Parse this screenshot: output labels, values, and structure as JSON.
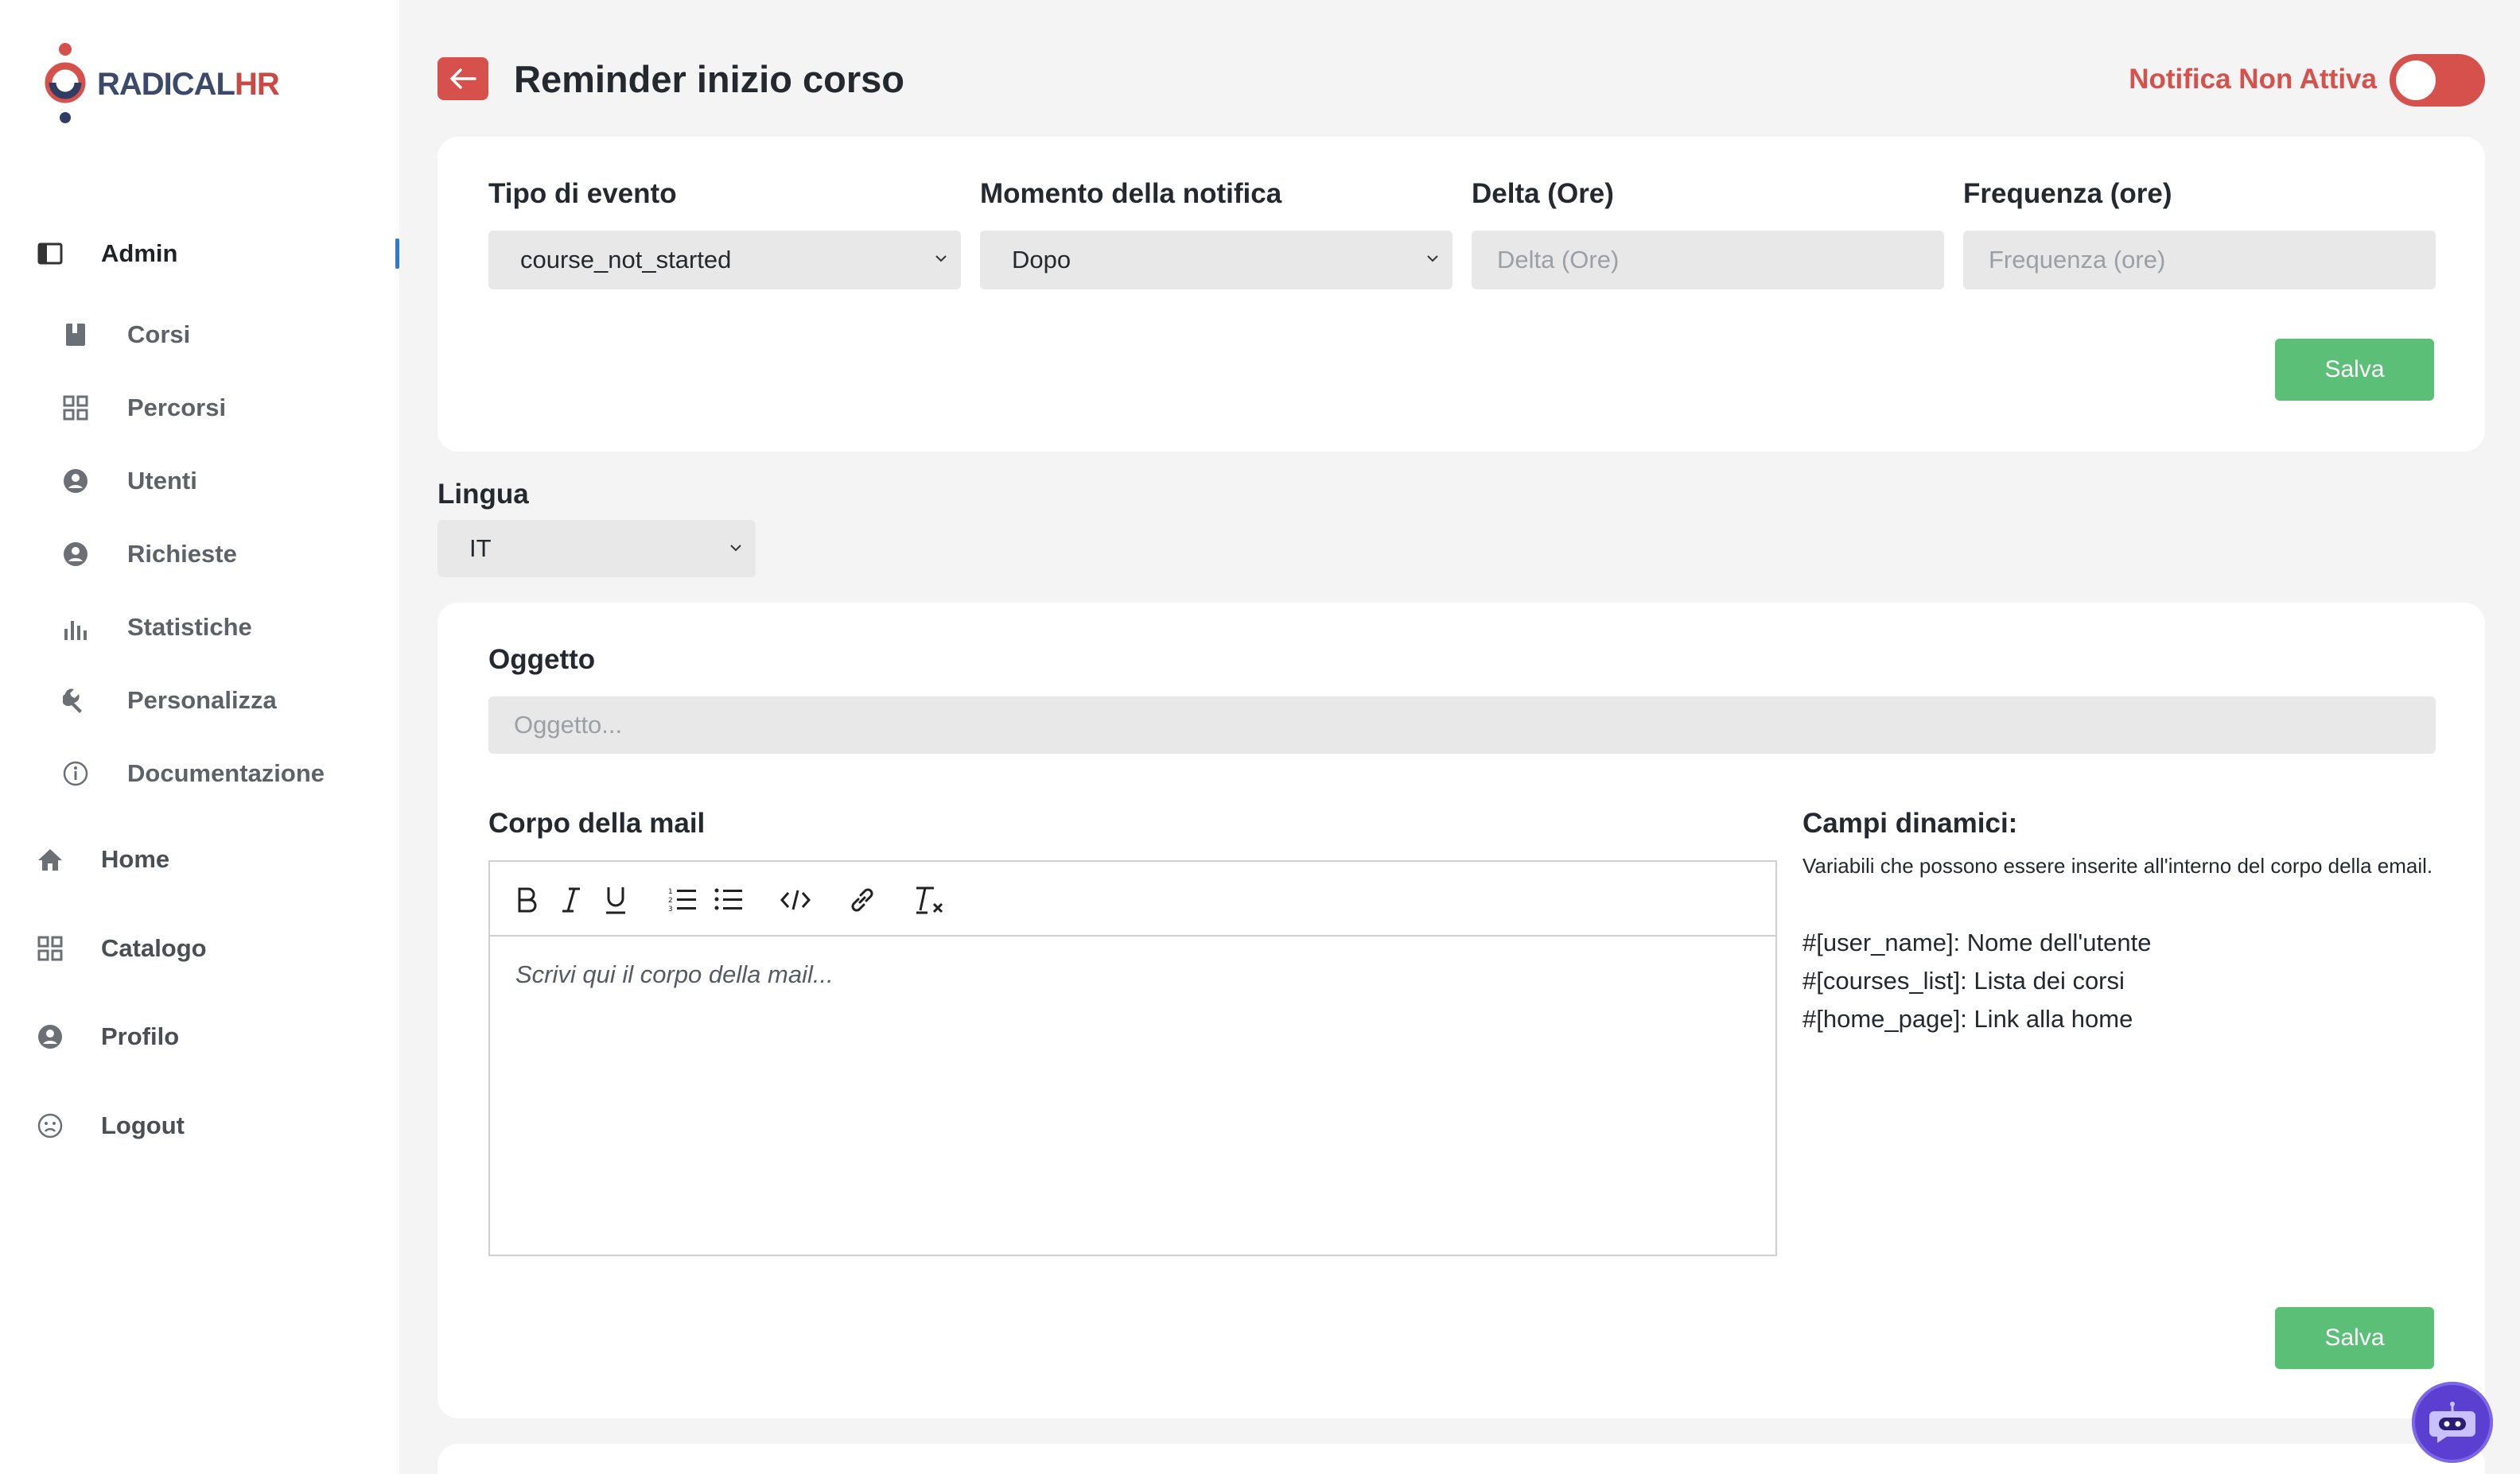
{
  "app": {
    "brand_part1": "RADICAL",
    "brand_part2": "HR"
  },
  "sidebar": {
    "items": [
      {
        "label": "Admin",
        "icon": "sidebar-panel-icon"
      },
      {
        "label": "Corsi",
        "icon": "book-icon"
      },
      {
        "label": "Percorsi",
        "icon": "grid-icon"
      },
      {
        "label": "Utenti",
        "icon": "user-circle-icon"
      },
      {
        "label": "Richieste",
        "icon": "user-circle-icon"
      },
      {
        "label": "Statistiche",
        "icon": "bar-chart-icon"
      },
      {
        "label": "Personalizza",
        "icon": "wrench-icon"
      },
      {
        "label": "Documentazione",
        "icon": "info-icon"
      },
      {
        "label": "Home",
        "icon": "home-icon"
      },
      {
        "label": "Catalogo",
        "icon": "grid-icon"
      },
      {
        "label": "Profilo",
        "icon": "user-circle-icon"
      },
      {
        "label": "Logout",
        "icon": "sad-face-icon"
      }
    ]
  },
  "header": {
    "title": "Reminder inizio corso",
    "notification_status": "Notifica Non Attiva",
    "notification_active": false
  },
  "settings": {
    "event_type_label": "Tipo di evento",
    "event_type_value": "course_not_started",
    "moment_label": "Momento della notifica",
    "moment_value": "Dopo",
    "delta_label": "Delta (Ore)",
    "delta_placeholder": "Delta (Ore)",
    "frequency_label": "Frequenza (ore)",
    "frequency_placeholder": "Frequenza (ore)",
    "save_label": "Salva"
  },
  "language": {
    "label": "Lingua",
    "value": "IT"
  },
  "email": {
    "subject_label": "Oggetto",
    "subject_placeholder": "Oggetto...",
    "body_label": "Corpo della mail",
    "body_placeholder": "Scrivi qui il corpo della mail...",
    "toolbar": [
      "bold-icon",
      "italic-icon",
      "underline-icon",
      "ordered-list-icon",
      "bullet-list-icon",
      "code-icon",
      "link-icon",
      "clear-format-icon"
    ],
    "dynamic_title": "Campi dinamici:",
    "dynamic_desc": "Variabili che possono essere inserite all'interno del corpo della email.",
    "dynamic_fields": [
      "#[user_name]: Nome dell'utente",
      "#[courses_list]: Lista dei corsi",
      "#[home_page]: Link alla home"
    ],
    "save_label": "Salva"
  },
  "colors": {
    "accent_red": "#d6504c",
    "save_green": "#5cbf78",
    "active_blue": "#2d7bd6",
    "chat_purple": "#5b3fd1"
  }
}
